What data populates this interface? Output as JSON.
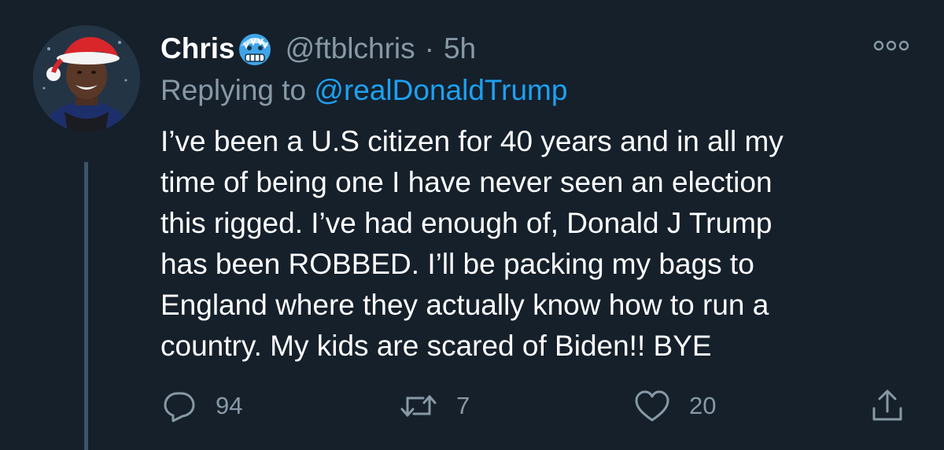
{
  "tweet": {
    "display_name": "Chris",
    "name_emoji": "cold-face-emoji",
    "handle": "@ftblchris",
    "separator": "·",
    "time": "5h",
    "replying_prefix": "Replying to ",
    "replying_to": "@realDonaldTrump",
    "text": "I’ve been a U.S citizen for 40 years and in all my\ntime of being one I have never seen an election\nthis rigged. I’ve had enough of, Donald J Trump\nhas been ROBBED. I’ll be packing my bags to\nEngland where they actually know how to run a\ncountry. My kids are scared of Biden!! BYE",
    "actions": {
      "replies": {
        "icon": "reply-icon",
        "count": "94"
      },
      "retweets": {
        "icon": "retweet-icon",
        "count": "7"
      },
      "likes": {
        "icon": "heart-icon",
        "count": "20"
      },
      "share": {
        "icon": "share-icon"
      }
    },
    "more_icon": "more-options-icon"
  },
  "colors": {
    "background": "#15202b",
    "text_primary": "#ffffff",
    "text_secondary": "#8899a6",
    "link": "#1da1f2",
    "thread_line": "#3d5466"
  }
}
